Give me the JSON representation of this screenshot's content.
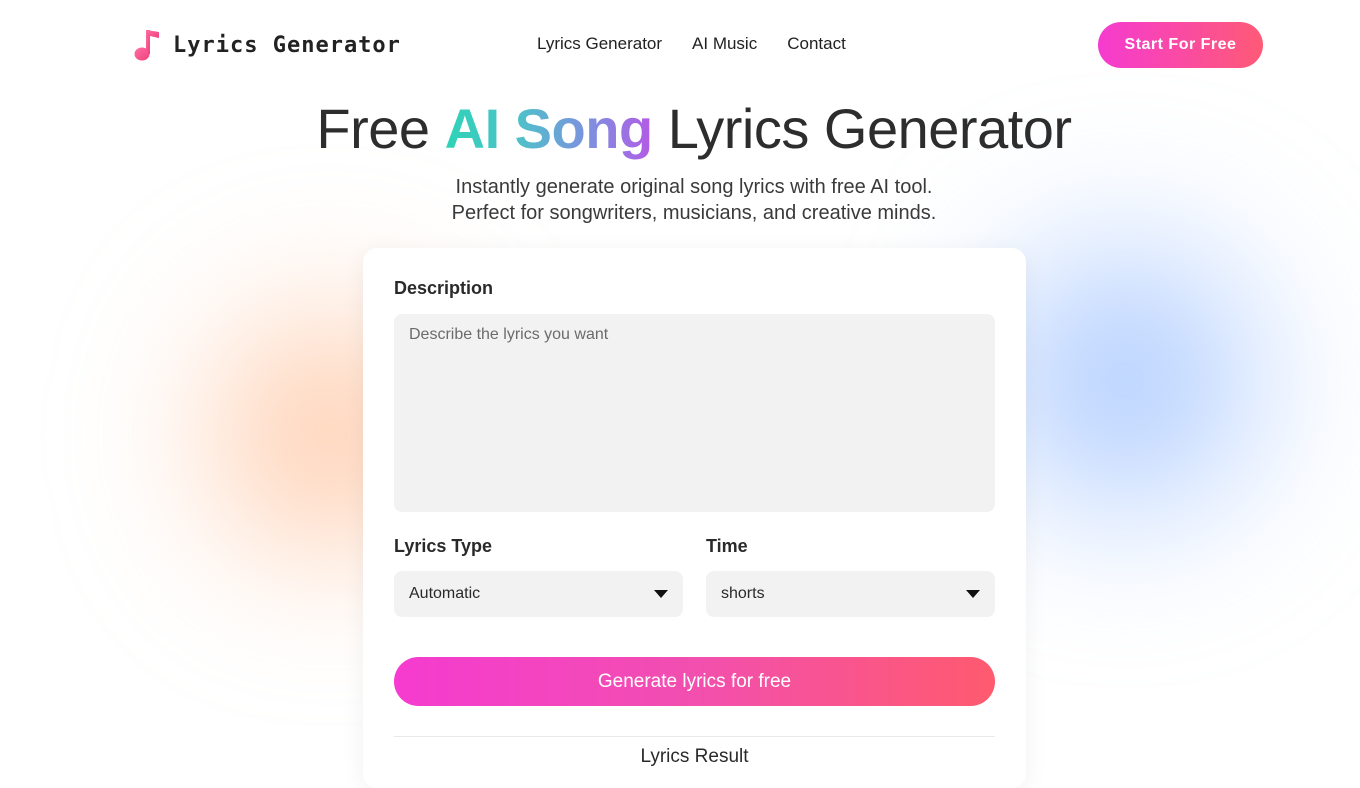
{
  "header": {
    "logo_text": "Lyrics Generator",
    "logo_icon": "music-note-icon",
    "nav": [
      {
        "label": "Lyrics Generator"
      },
      {
        "label": "AI Music"
      },
      {
        "label": "Contact"
      }
    ],
    "cta_label": "Start For Free"
  },
  "hero": {
    "title_prefix": "Free ",
    "title_accent": "AI Song",
    "title_suffix": " Lyrics Generator",
    "subtitle_line1": "Instantly generate original song lyrics with free AI tool.",
    "subtitle_line2": "Perfect for songwriters, musicians, and creative minds."
  },
  "form": {
    "description_label": "Description",
    "description_placeholder": "Describe the lyrics you want",
    "description_value": "",
    "lyrics_type_label": "Lyrics Type",
    "lyrics_type_value": "Automatic",
    "time_label": "Time",
    "time_value": "shorts",
    "generate_label": "Generate lyrics for free",
    "result_title": "Lyrics Result"
  },
  "colors": {
    "brand_gradient_start": "#f53bd0",
    "brand_gradient_end": "#ff5a76",
    "accent_text_start": "#2ed3b7",
    "accent_text_end": "#b35ae6",
    "field_background": "#f2f2f2"
  }
}
